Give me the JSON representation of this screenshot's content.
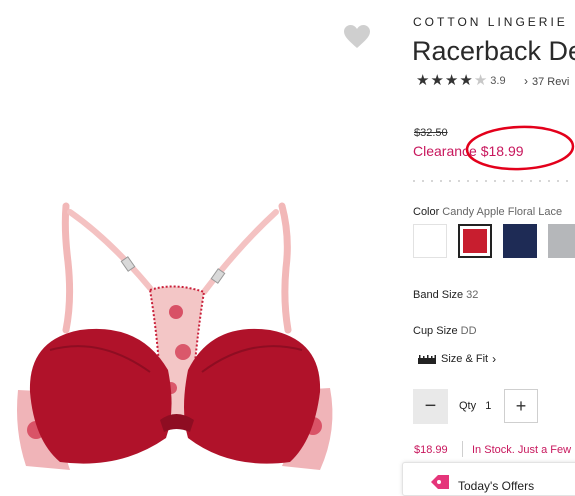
{
  "product": {
    "brand": "COTTON LINGERIE",
    "title": "Racerback De",
    "rating": "3.9",
    "reviews": "37 Revi"
  },
  "price": {
    "original": "$32.50",
    "sale": "Clearance $18.99",
    "annotation_color": "#e3001b"
  },
  "color": {
    "label": "Color",
    "value": "Candy Apple Floral Lace",
    "swatches": [
      "#ffffff",
      "#c81e2f",
      "#1e2b55",
      "#b5b7ba"
    ]
  },
  "band": {
    "label": "Band Size",
    "value": "32"
  },
  "cup": {
    "label": "Cup Size",
    "value": "DD"
  },
  "size_fit": {
    "label": "Size & Fit"
  },
  "quantity": {
    "label": "Qty",
    "value": "1",
    "minus": "−",
    "plus": "+"
  },
  "availability": {
    "price": "$18.99",
    "status": "In Stock. Just a Few"
  },
  "offers": {
    "label": "Today's Offers"
  },
  "icons": {
    "favorite": "heart-icon",
    "stars": "star-icon",
    "reviews": "chevron-right-icon",
    "size_fit": "ruler-icon",
    "offers": "tag-icon"
  },
  "accent_color": "#c8175d"
}
